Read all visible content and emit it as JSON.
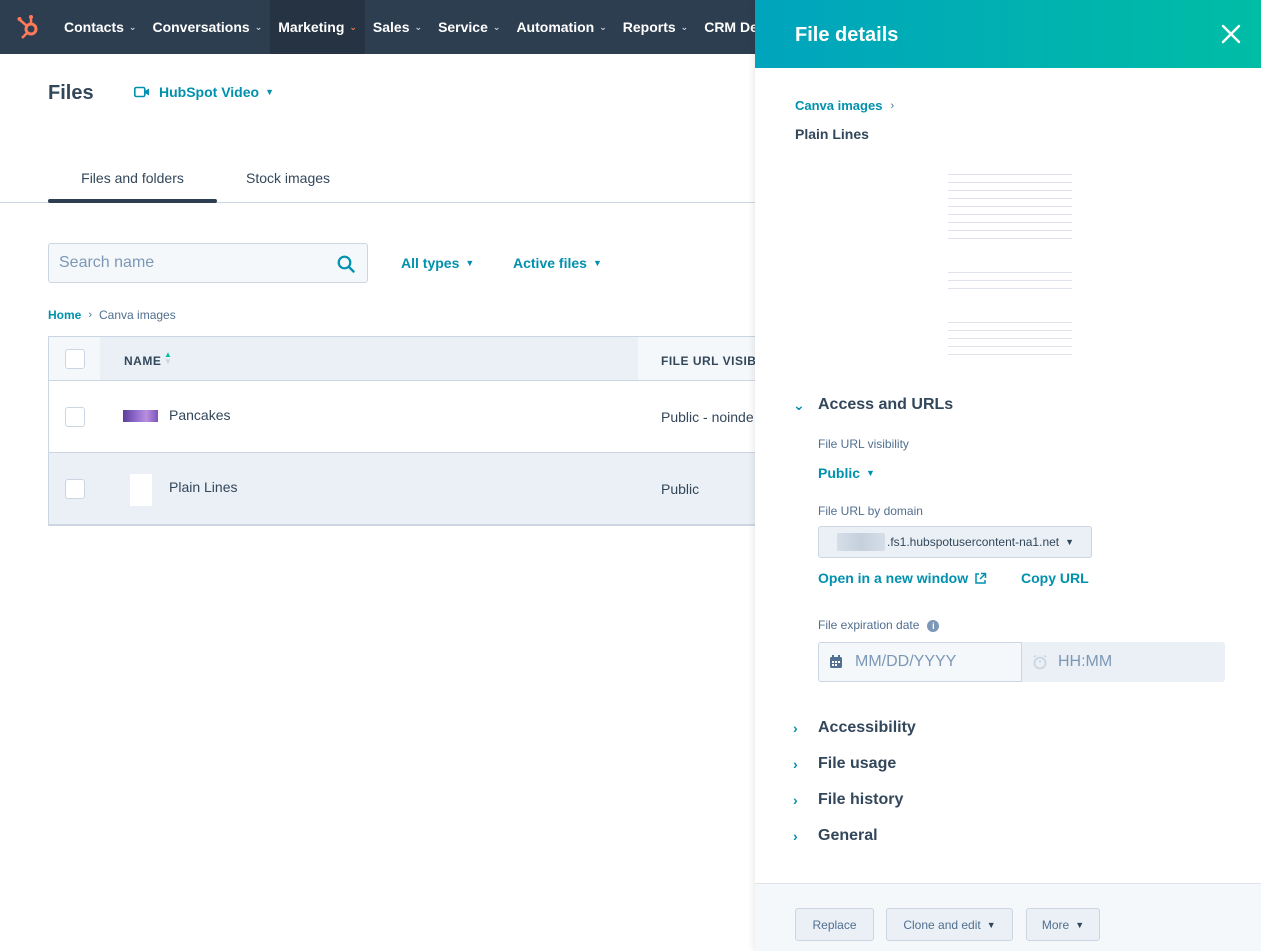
{
  "nav": {
    "items": [
      {
        "label": "Contacts"
      },
      {
        "label": "Conversations"
      },
      {
        "label": "Marketing"
      },
      {
        "label": "Sales"
      },
      {
        "label": "Service"
      },
      {
        "label": "Automation"
      },
      {
        "label": "Reports"
      },
      {
        "label": "CRM Deve"
      }
    ],
    "accent": "#ff7a59",
    "bg": "#2d3e50"
  },
  "page": {
    "title": "Files",
    "video_label": "HubSpot Video",
    "tabs": [
      {
        "label": "Files and folders"
      },
      {
        "label": "Stock images"
      }
    ],
    "search_placeholder": "Search name",
    "filters": [
      {
        "label": "All types"
      },
      {
        "label": "Active files"
      }
    ],
    "breadcrumb": {
      "home": "Home",
      "current": "Canva images"
    }
  },
  "table": {
    "headers": {
      "name": "NAME",
      "visibility": "FILE URL VISIBI"
    },
    "rows": [
      {
        "name": "Pancakes",
        "visibility": "Public - noinde"
      },
      {
        "name": "Plain Lines",
        "visibility": "Public"
      }
    ]
  },
  "panel": {
    "title": "File details",
    "breadcrumb": "Canva images",
    "file_name": "Plain Lines",
    "access_title": "Access and URLs",
    "visibility_label": "File URL visibility",
    "visibility_value": "Public",
    "domain_label": "File URL by domain",
    "domain_value": ".fs1.hubspotusercontent-na1.net",
    "open_window": "Open in a new window",
    "copy_url": "Copy URL",
    "expiration_label": "File expiration date",
    "date_placeholder": "MM/DD/YYYY",
    "time_placeholder": "HH:MM",
    "sections": [
      {
        "label": "Accessibility"
      },
      {
        "label": "File usage"
      },
      {
        "label": "File history"
      },
      {
        "label": "General"
      }
    ],
    "footer": {
      "replace": "Replace",
      "clone": "Clone and edit",
      "more": "More"
    },
    "header_gradient": [
      "#00a4bd",
      "#00bda5"
    ]
  }
}
